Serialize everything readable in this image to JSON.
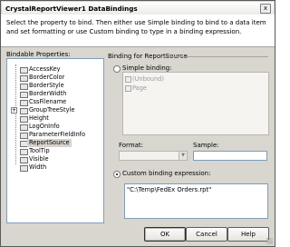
{
  "window": {
    "title": "CrystalReportViewer1 DataBindings",
    "close_glyph": "x"
  },
  "description": "Select the property to bind. Then either use Simple binding to bind to a data item and set formatting or use Custom binding to type in a binding expression.",
  "bindable_properties": {
    "label": "Bindable Properties:",
    "items": [
      {
        "label": "AccessKey"
      },
      {
        "label": "BorderColor"
      },
      {
        "label": "BorderStyle"
      },
      {
        "label": "BorderWidth"
      },
      {
        "label": "CssFilename"
      },
      {
        "label": "GroupTreeStyle",
        "expandable": true
      },
      {
        "label": "Height"
      },
      {
        "label": "LogOnInfo"
      },
      {
        "label": "ParameterFieldInfo"
      },
      {
        "label": "ReportSource",
        "selected": true
      },
      {
        "label": "ToolTip"
      },
      {
        "label": "Visible"
      },
      {
        "label": "Width"
      }
    ]
  },
  "binding_group": {
    "label": "Binding for ReportSource",
    "simple_label": "Simple binding:",
    "tree": [
      "(Unbound)",
      "Page"
    ],
    "format_label": "Format:",
    "sample_label": "Sample:",
    "custom_label": "Custom binding expression:",
    "custom_value": "\"C:\\Temp\\FedEx Orders.rpt\"",
    "selected_mode": "custom"
  },
  "buttons": {
    "ok": "OK",
    "cancel": "Cancel",
    "help": "Help"
  },
  "icons": {
    "expand": "+"
  }
}
